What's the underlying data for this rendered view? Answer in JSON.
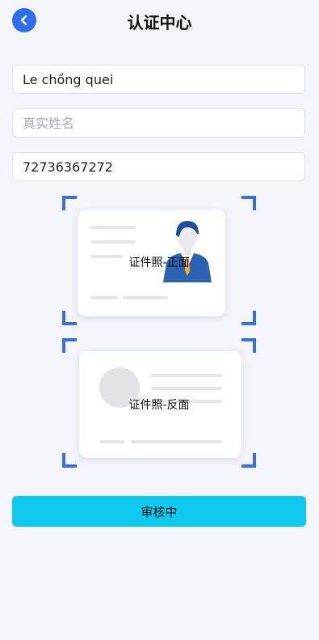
{
  "header": {
    "title": "认证中心",
    "back_icon": "chevron-left-icon",
    "accent": "#2f6df0"
  },
  "form": {
    "username": {
      "value": "Le chồng quei",
      "placeholder": ""
    },
    "realname": {
      "value": "",
      "placeholder": "真实姓名"
    },
    "phone": {
      "value": "72736367272",
      "placeholder": ""
    }
  },
  "uploads": {
    "front_label": "证件照-正面",
    "back_label": "证件照-反面",
    "frame_color": "#3b6fe0"
  },
  "submit": {
    "label": "审核中",
    "color": "#0fc9ef"
  }
}
